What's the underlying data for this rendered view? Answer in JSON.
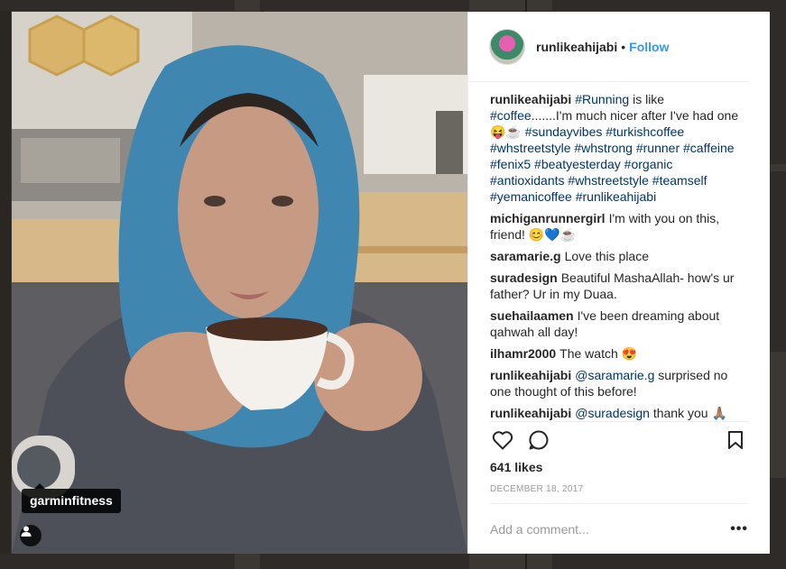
{
  "post": {
    "author": "runlikeahijabi",
    "separator": "•",
    "follow_label": "Follow",
    "photo_tag": "garminfitness",
    "likes": "641 likes",
    "date": "DECEMBER 18, 2017",
    "add_comment_placeholder": "Add a comment...",
    "more_label": "•••"
  },
  "caption": {
    "user": "runlikeahijabi",
    "segments": [
      {
        "text": "#Running",
        "tag": true
      },
      {
        "text": " is like ",
        "tag": false
      },
      {
        "text": "#coffee",
        "tag": true
      },
      {
        "text": ".......I'm much nicer after I've had one 😝☕ ",
        "tag": false
      },
      {
        "text": "#sundayvibes",
        "tag": true
      },
      {
        "text": " ",
        "tag": false
      },
      {
        "text": "#turkishcoffee",
        "tag": true
      },
      {
        "text": " ",
        "tag": false
      },
      {
        "text": "#whstreetstyle",
        "tag": true
      },
      {
        "text": " ",
        "tag": false
      },
      {
        "text": "#whstrong",
        "tag": true
      },
      {
        "text": " ",
        "tag": false
      },
      {
        "text": "#runner",
        "tag": true
      },
      {
        "text": " ",
        "tag": false
      },
      {
        "text": "#caffeine",
        "tag": true
      },
      {
        "text": " ",
        "tag": false
      },
      {
        "text": "#fenix5",
        "tag": true
      },
      {
        "text": " ",
        "tag": false
      },
      {
        "text": "#beatyesterday",
        "tag": true
      },
      {
        "text": " ",
        "tag": false
      },
      {
        "text": "#organic",
        "tag": true
      },
      {
        "text": " ",
        "tag": false
      },
      {
        "text": "#antioxidants",
        "tag": true
      },
      {
        "text": " ",
        "tag": false
      },
      {
        "text": "#whstreetstyle",
        "tag": true
      },
      {
        "text": " ",
        "tag": false
      },
      {
        "text": "#teamself",
        "tag": true
      },
      {
        "text": " ",
        "tag": false
      },
      {
        "text": "#yemanicoffee",
        "tag": true
      },
      {
        "text": " ",
        "tag": false
      },
      {
        "text": "#runlikeahijabi",
        "tag": true
      }
    ]
  },
  "comments": [
    {
      "user": "michiganrunnergirl",
      "segments": [
        {
          "text": "I'm with you on this, friend! 😊💙☕",
          "tag": false
        }
      ]
    },
    {
      "user": "saramarie.g",
      "segments": [
        {
          "text": "Love this place",
          "tag": false
        }
      ]
    },
    {
      "user": "suradesign",
      "segments": [
        {
          "text": "Beautiful MashaAllah- how's ur father? Ur in my Duaa.",
          "tag": false
        }
      ]
    },
    {
      "user": "suehailaamen",
      "segments": [
        {
          "text": "I've been dreaming about qahwah all day!",
          "tag": false
        }
      ]
    },
    {
      "user": "ilhamr2000",
      "segments": [
        {
          "text": "The watch 😍",
          "tag": false
        }
      ]
    },
    {
      "user": "runlikeahijabi",
      "segments": [
        {
          "text": "@saramarie.g",
          "tag": true
        },
        {
          "text": " surprised no one thought of this before!",
          "tag": false
        }
      ]
    },
    {
      "user": "runlikeahijabi",
      "segments": [
        {
          "text": "@suradesign",
          "tag": true
        },
        {
          "text": " thank you 🙏🏽",
          "tag": false
        }
      ]
    }
  ],
  "icons": {
    "like": "heart-icon",
    "comment": "comment-bubble-icon",
    "save": "bookmark-icon",
    "tags": "user-tag-icon"
  },
  "colors": {
    "link": "#003569",
    "follow": "#3897f0",
    "muted": "#999999"
  }
}
